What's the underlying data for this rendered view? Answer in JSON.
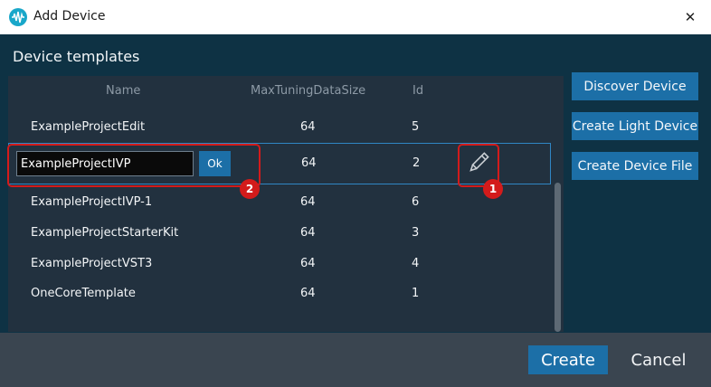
{
  "window": {
    "title": "Add Device",
    "close_glyph": "✕"
  },
  "section_title": "Device templates",
  "table": {
    "columns": [
      "Name",
      "MaxTuningDataSize",
      "Id"
    ],
    "rows": [
      {
        "name": "ExampleProjectEdit",
        "size": "64",
        "id": "5"
      },
      {
        "name": "ExampleProjectIVP",
        "size": "64",
        "id": "2"
      },
      {
        "name": "ExampleProjectIVP-1",
        "size": "64",
        "id": "6"
      },
      {
        "name": "ExampleProjectStarterKit",
        "size": "64",
        "id": "3"
      },
      {
        "name": "ExampleProjectVST3",
        "size": "64",
        "id": "4"
      },
      {
        "name": "OneCoreTemplate",
        "size": "64",
        "id": "1"
      }
    ],
    "edit_row": {
      "input_value": "ExampleProjectIVP",
      "ok_label": "Ok"
    }
  },
  "annotations": {
    "badge_1": "1",
    "badge_2": "2"
  },
  "side_buttons": [
    "Discover Device",
    "Create Light Device",
    "Create Device File"
  ],
  "footer": {
    "create_label": "Create",
    "cancel_label": "Cancel"
  },
  "colors": {
    "accent": "#1c6fa7",
    "callout": "#d31b1b",
    "background": "#0e3244",
    "table_bg": "#22313f"
  }
}
